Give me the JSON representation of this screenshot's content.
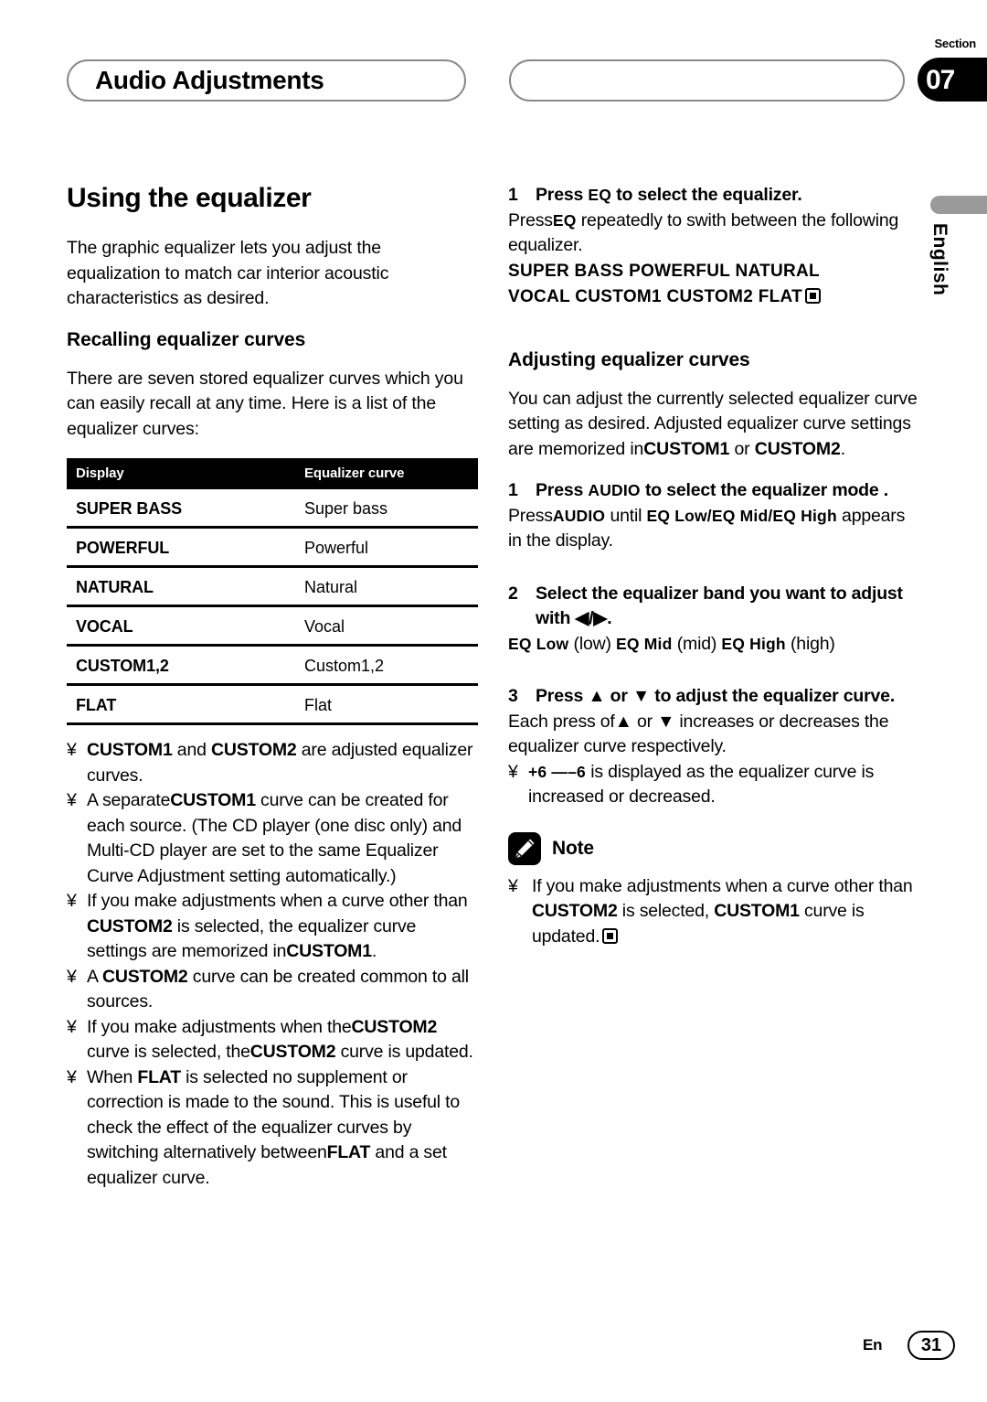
{
  "header": {
    "title": "Audio Adjustments",
    "section_label": "Section",
    "section_number": "07"
  },
  "language_tab": {
    "label": "English"
  },
  "left_column": {
    "title": "Using the equalizer",
    "intro": "The graphic equalizer lets you adjust the equalization to match car interior acoustic characteristics as desired.",
    "subsection": {
      "title": "Recalling equalizer curves",
      "intro": "There are seven stored equalizer curves which you can easily recall at any time. Here is a list of the equalizer curves:"
    },
    "table": {
      "headers": [
        "Display",
        "Equalizer curve"
      ],
      "rows": [
        {
          "display": "SUPER BASS",
          "curve": "Super bass"
        },
        {
          "display": "POWERFUL",
          "curve": "Powerful"
        },
        {
          "display": "NATURAL",
          "curve": "Natural"
        },
        {
          "display": "VOCAL",
          "curve": "Vocal"
        },
        {
          "display": "CUSTOM1,2",
          "curve": "Custom1,2"
        },
        {
          "display": "FLAT",
          "curve": "Flat"
        }
      ]
    },
    "bullet_char": "¥",
    "notes": [
      {
        "id": "note-custom-adjusted",
        "parts": [
          {
            "t": "b",
            "v": "CUSTOM1"
          },
          {
            "t": "n",
            "v": " and "
          },
          {
            "t": "b",
            "v": "CUSTOM2"
          },
          {
            "t": "n",
            "v": " are adjusted equalizer curves."
          }
        ]
      },
      {
        "id": "note-separate-custom1",
        "parts": [
          {
            "t": "n",
            "v": "A separate"
          },
          {
            "t": "b",
            "v": "CUSTOM1"
          },
          {
            "t": "n",
            "v": " curve can be created for each source. (The CD player (one disc only) and Multi-CD player are set to the same Equalizer Curve Adjustment setting automatically.)"
          }
        ]
      },
      {
        "id": "note-adjust-other-curve",
        "parts": [
          {
            "t": "n",
            "v": "If you make adjustments when a curve other than "
          },
          {
            "t": "b",
            "v": "CUSTOM2"
          },
          {
            "t": "n",
            "v": " is selected, the equalizer curve settings are memorized in"
          },
          {
            "t": "b",
            "v": "CUSTOM1"
          },
          {
            "t": "n",
            "v": "."
          }
        ]
      },
      {
        "id": "note-custom2-common",
        "parts": [
          {
            "t": "n",
            "v": "A "
          },
          {
            "t": "b",
            "v": "CUSTOM2"
          },
          {
            "t": "n",
            "v": " curve can be created common to all sources."
          }
        ]
      },
      {
        "id": "note-custom2-updated",
        "parts": [
          {
            "t": "n",
            "v": "If you make adjustments when the"
          },
          {
            "t": "b",
            "v": "CUSTOM2"
          },
          {
            "t": "n",
            "v": " curve is selected, the"
          },
          {
            "t": "b",
            "v": "CUSTOM2"
          },
          {
            "t": "n",
            "v": " curve is updated."
          }
        ]
      },
      {
        "id": "note-flat",
        "parts": [
          {
            "t": "n",
            "v": "When "
          },
          {
            "t": "b",
            "v": "FLAT"
          },
          {
            "t": "n",
            "v": " is selected no supplement or correction is made to the sound. This is useful to check the effect of the equalizer curves by switching alternatively between"
          },
          {
            "t": "b",
            "v": "FLAT"
          },
          {
            "t": "n",
            "v": " and a set equalizer curve."
          }
        ]
      }
    ]
  },
  "right_column": {
    "step_eq": {
      "number": "1",
      "heading_parts": [
        {
          "t": "n",
          "v": "Press "
        },
        {
          "t": "k",
          "v": "EQ"
        },
        {
          "t": "n",
          "v": " to select the equalizer."
        }
      ],
      "body_parts": [
        {
          "t": "n",
          "v": "Press"
        },
        {
          "t": "k",
          "v": "EQ"
        },
        {
          "t": "n",
          "v": " repeatedly to swith between the following equalizer."
        }
      ],
      "curves_line_1": "SUPER BASS   POWERFUL   NATURAL",
      "curves_line_2": "VOCAL   CUSTOM1   CUSTOM2   FLAT"
    },
    "subsection": {
      "title": "Adjusting equalizer curves",
      "intro_parts": [
        {
          "t": "n",
          "v": "You can adjust the currently selected equalizer curve setting as desired. Adjusted equalizer curve settings are memorized in"
        },
        {
          "t": "b",
          "v": "CUSTOM1"
        },
        {
          "t": "n",
          "v": " or "
        },
        {
          "t": "b",
          "v": "CUSTOM2"
        },
        {
          "t": "n",
          "v": "."
        }
      ]
    },
    "steps": [
      {
        "number": "1",
        "heading_parts": [
          {
            "t": "n",
            "v": "Press "
          },
          {
            "t": "k",
            "v": "AUDIO"
          },
          {
            "t": "n",
            "v": " to select the  equalizer mode ."
          }
        ],
        "body_parts": [
          {
            "t": "n",
            "v": "Press"
          },
          {
            "t": "k",
            "v": "AUDIO"
          },
          {
            "t": "n",
            "v": " until "
          },
          {
            "t": "k",
            "v": "EQ Low/EQ Mid/EQ High"
          },
          {
            "t": "n",
            "v": " appears in the display."
          }
        ]
      },
      {
        "number": "2",
        "heading_parts": [
          {
            "t": "n",
            "v": "Select the equalizer band you want to adjust with ◀/▶."
          }
        ],
        "body_parts": [
          {
            "t": "k",
            "v": "EQ Low"
          },
          {
            "t": "n",
            "v": " (low)   "
          },
          {
            "t": "k",
            "v": "EQ Mid"
          },
          {
            "t": "n",
            "v": " (mid)   "
          },
          {
            "t": "k",
            "v": "EQ High"
          },
          {
            "t": "n",
            "v": " (high)"
          }
        ]
      },
      {
        "number": "3",
        "heading_parts": [
          {
            "t": "n",
            "v": "Press ▲ or ▼ to adjust the equalizer curve."
          }
        ],
        "body_parts": [
          {
            "t": "n",
            "v": "Each press of▲ or ▼ increases or decreases the equalizer curve respectively."
          }
        ]
      }
    ],
    "bullet_char": "¥",
    "step3_bullet_parts": [
      {
        "t": "k",
        "v": "+6 —–6"
      },
      {
        "t": "n",
        "v": " is displayed as the equalizer curve is increased or decreased."
      }
    ],
    "note": {
      "label": "Note",
      "bullet_char": "¥",
      "parts": [
        {
          "t": "n",
          "v": "If you make adjustments when a curve other than "
        },
        {
          "t": "b",
          "v": "CUSTOM2"
        },
        {
          "t": "n",
          "v": " is selected, "
        },
        {
          "t": "b",
          "v": "CUSTOM1"
        },
        {
          "t": "n",
          "v": " curve is updated."
        }
      ]
    }
  },
  "footer": {
    "language_code": "En",
    "page_number": "31"
  }
}
